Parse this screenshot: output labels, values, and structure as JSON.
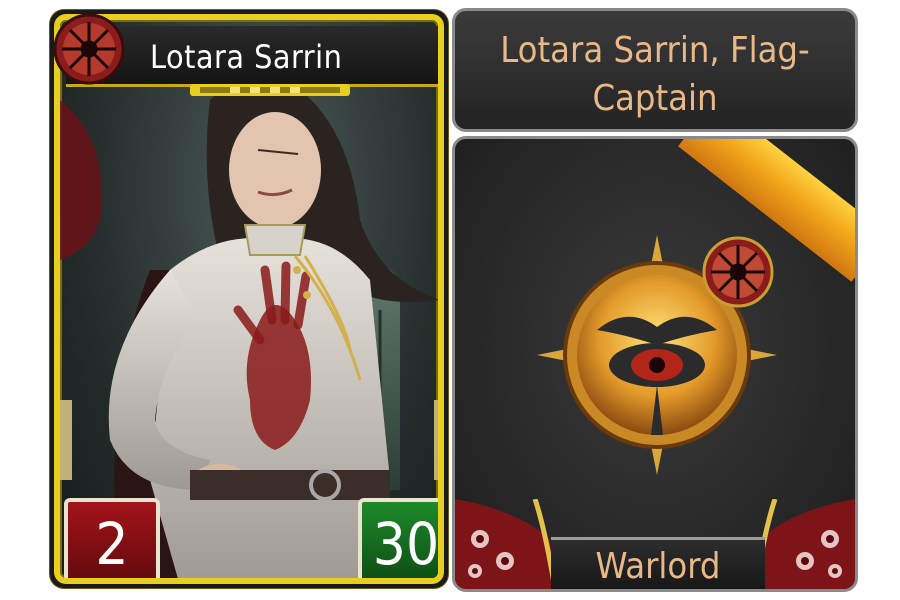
{
  "card_front": {
    "name": "Lotara Sarrin",
    "cost": "2",
    "hit_points": "30",
    "faction_icon": "chaos-star-icon"
  },
  "card_back": {
    "title": "Lotara Sarrin, Flag-Captain",
    "type_label": "Warlord",
    "emblem_icon": "eye-of-horus-icon",
    "faction_icon": "chaos-star-icon"
  },
  "colors": {
    "card_frame": "#e8cf1f",
    "title_text": "#e8b889",
    "cost_box": "#a3141a",
    "hp_box": "#1d8a2a",
    "ribbon": "#f1a51a"
  }
}
